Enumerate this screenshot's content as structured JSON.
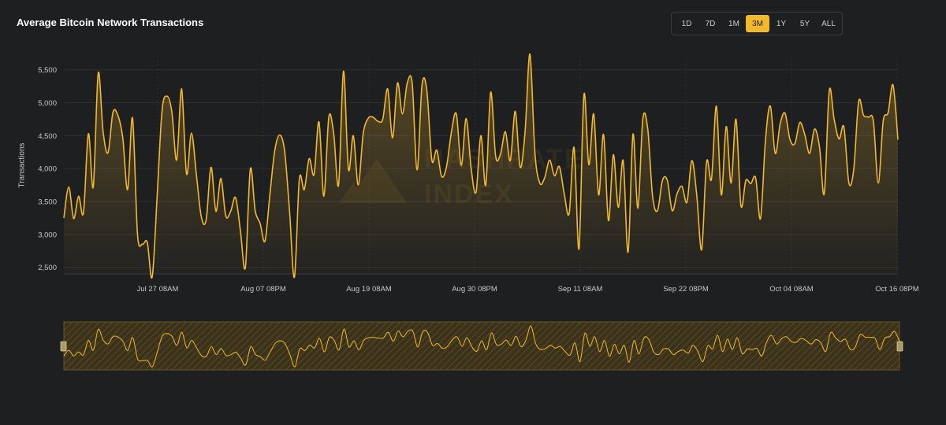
{
  "header": {
    "title": "Average Bitcoin Network Transactions"
  },
  "range_selector": {
    "buttons": [
      {
        "label": "1D",
        "active": false
      },
      {
        "label": "7D",
        "active": false
      },
      {
        "label": "1M",
        "active": false
      },
      {
        "label": "3M",
        "active": true
      },
      {
        "label": "1Y",
        "active": false
      },
      {
        "label": "5Y",
        "active": false
      },
      {
        "label": "ALL",
        "active": false
      }
    ]
  },
  "colors": {
    "background": "#1e1f21",
    "line": "#f2b92b",
    "grid": "#2e2f32",
    "axis_text": "#c8c8c8",
    "navigator_bg": "#3a321c"
  },
  "chart_data": {
    "type": "area",
    "title": "Average Bitcoin Network Transactions",
    "ylabel": "Transactions",
    "xlabel": "",
    "ylim": [
      2400,
      5700
    ],
    "yticks": [
      2500,
      3000,
      3500,
      4000,
      4500,
      5000,
      5500
    ],
    "ytick_labels": [
      "2,500",
      "3,000",
      "3,500",
      "4,000",
      "4,500",
      "5,000",
      "5,500"
    ],
    "xtick_labels": [
      "Jul 27 08AM",
      "Aug 07 08PM",
      "Aug 19 08AM",
      "Aug 30 08PM",
      "Sep 11 08AM",
      "Sep 22 08PM",
      "Oct 04 08AM",
      "Oct 16 08PM"
    ],
    "grid": true,
    "legend": "none",
    "watermark": "HASHRATE INDEX",
    "x_start": "Jul 16 08AM",
    "x_end": "Oct 16 08PM",
    "values": [
      3250,
      3720,
      3240,
      3580,
      3330,
      4530,
      3720,
      5450,
      4560,
      4240,
      4850,
      4810,
      4470,
      3680,
      4770,
      3010,
      2850,
      2880,
      2350,
      3550,
      4870,
      5100,
      4870,
      4130,
      5210,
      3920,
      4540,
      3920,
      3270,
      3220,
      4020,
      3350,
      3850,
      3280,
      3350,
      3560,
      3050,
      2500,
      3990,
      3360,
      3170,
      2900,
      3610,
      4280,
      4510,
      4260,
      3350,
      2350,
      3840,
      3680,
      4150,
      3910,
      4710,
      3580,
      4780,
      4530,
      3750,
      5480,
      3990,
      4500,
      3750,
      4520,
      4760,
      4780,
      4720,
      4750,
      5210,
      4470,
      5300,
      4830,
      5300,
      5290,
      3980,
      5270,
      5180,
      4130,
      4280,
      3880,
      4030,
      4560,
      4830,
      4050,
      4760,
      4010,
      3640,
      4500,
      3750,
      5160,
      4190,
      4220,
      4560,
      4120,
      4870,
      4020,
      4550,
      5740,
      4250,
      3780,
      3860,
      4130,
      3890,
      4030,
      3610,
      3320,
      4320,
      2780,
      5120,
      4060,
      4830,
      3600,
      4520,
      3210,
      4210,
      3410,
      4120,
      2730,
      4520,
      3400,
      4750,
      4610,
      3580,
      3360,
      3820,
      3820,
      3360,
      3620,
      3730,
      3490,
      4120,
      3600,
      2770,
      4100,
      3840,
      4950,
      3600,
      4640,
      3780,
      4750,
      3440,
      3820,
      3770,
      3860,
      3240,
      4430,
      4950,
      4230,
      4680,
      4840,
      4440,
      4380,
      4700,
      4520,
      4230,
      4600,
      4340,
      3620,
      5180,
      4750,
      4450,
      4630,
      3780,
      3990,
      5020,
      4810,
      4780,
      4720,
      3780,
      4720,
      4850,
      5270,
      4440
    ]
  },
  "navigator": {
    "label": "range navigator"
  }
}
